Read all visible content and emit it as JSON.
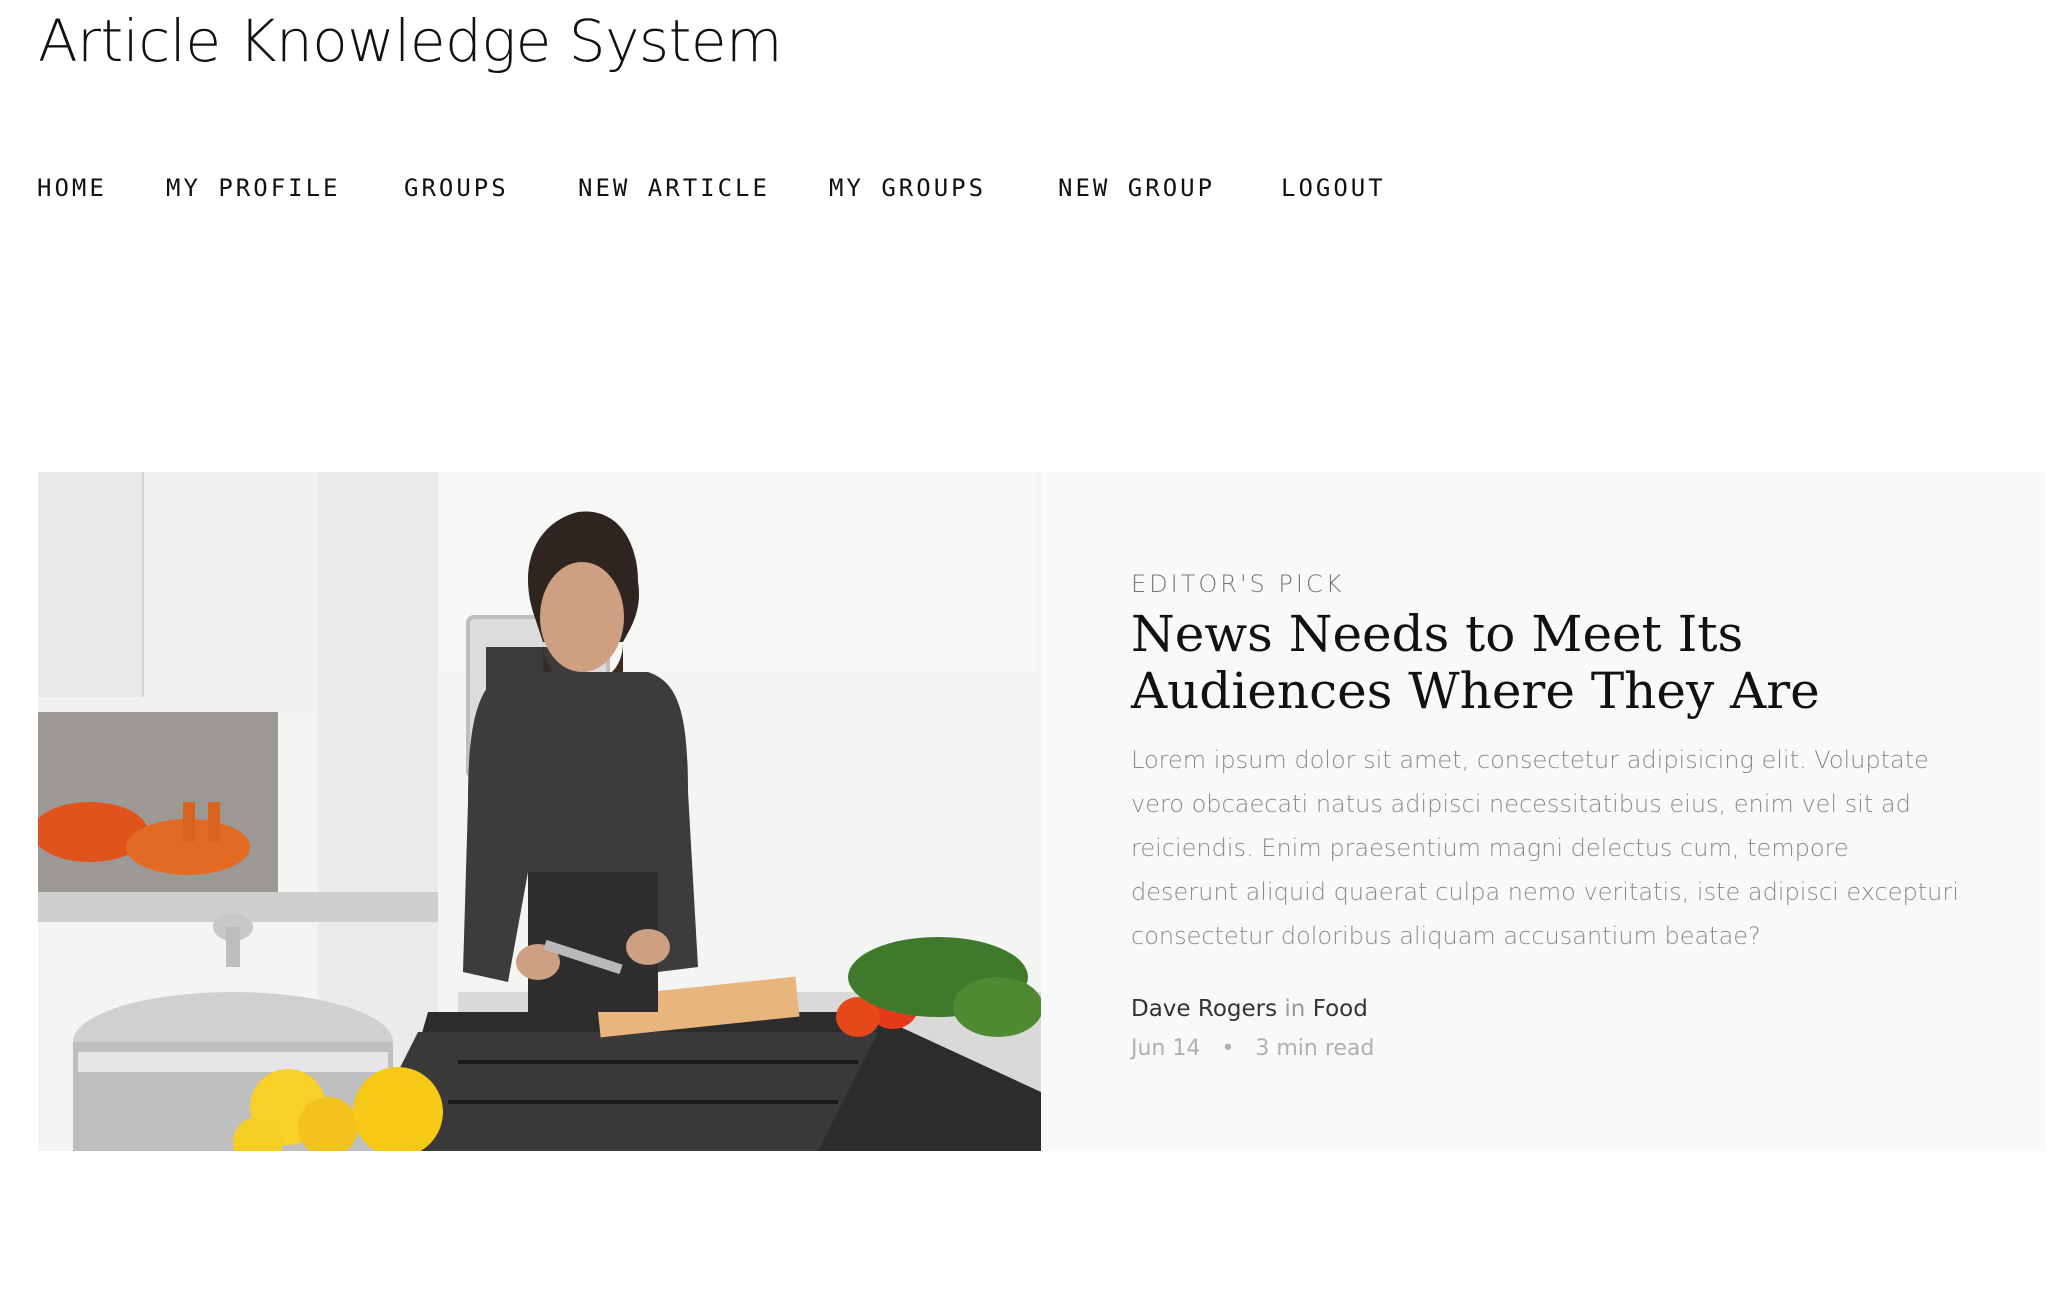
{
  "site": {
    "title": "Article Knowledge System"
  },
  "nav": {
    "items": [
      {
        "label": "HOME"
      },
      {
        "label": "MY PROFILE"
      },
      {
        "label": "GROUPS"
      },
      {
        "label": "NEW ARTICLE"
      },
      {
        "label": "MY GROUPS"
      },
      {
        "label": "NEW GROUP"
      },
      {
        "label": "LOGOUT"
      }
    ]
  },
  "featured": {
    "kicker": "EDITOR'S PICK",
    "title": "News Needs to Meet Its Audiences Where They Are",
    "excerpt": "Lorem ipsum dolor sit amet, consectetur adipisicing elit. Voluptate vero obcaecati natus adipisci necessitatibus eius, enim vel sit ad reiciendis. Enim praesentium magni delectus cum, tempore deserunt aliquid quaerat culpa nemo veritatis, iste adipisci excepturi consectetur doloribus aliquam accusantium beatae?",
    "author": "Dave Rogers",
    "in_word": "in",
    "category": "Food",
    "date": "Jun 14",
    "separator": "•",
    "read_time": "3 min read"
  }
}
